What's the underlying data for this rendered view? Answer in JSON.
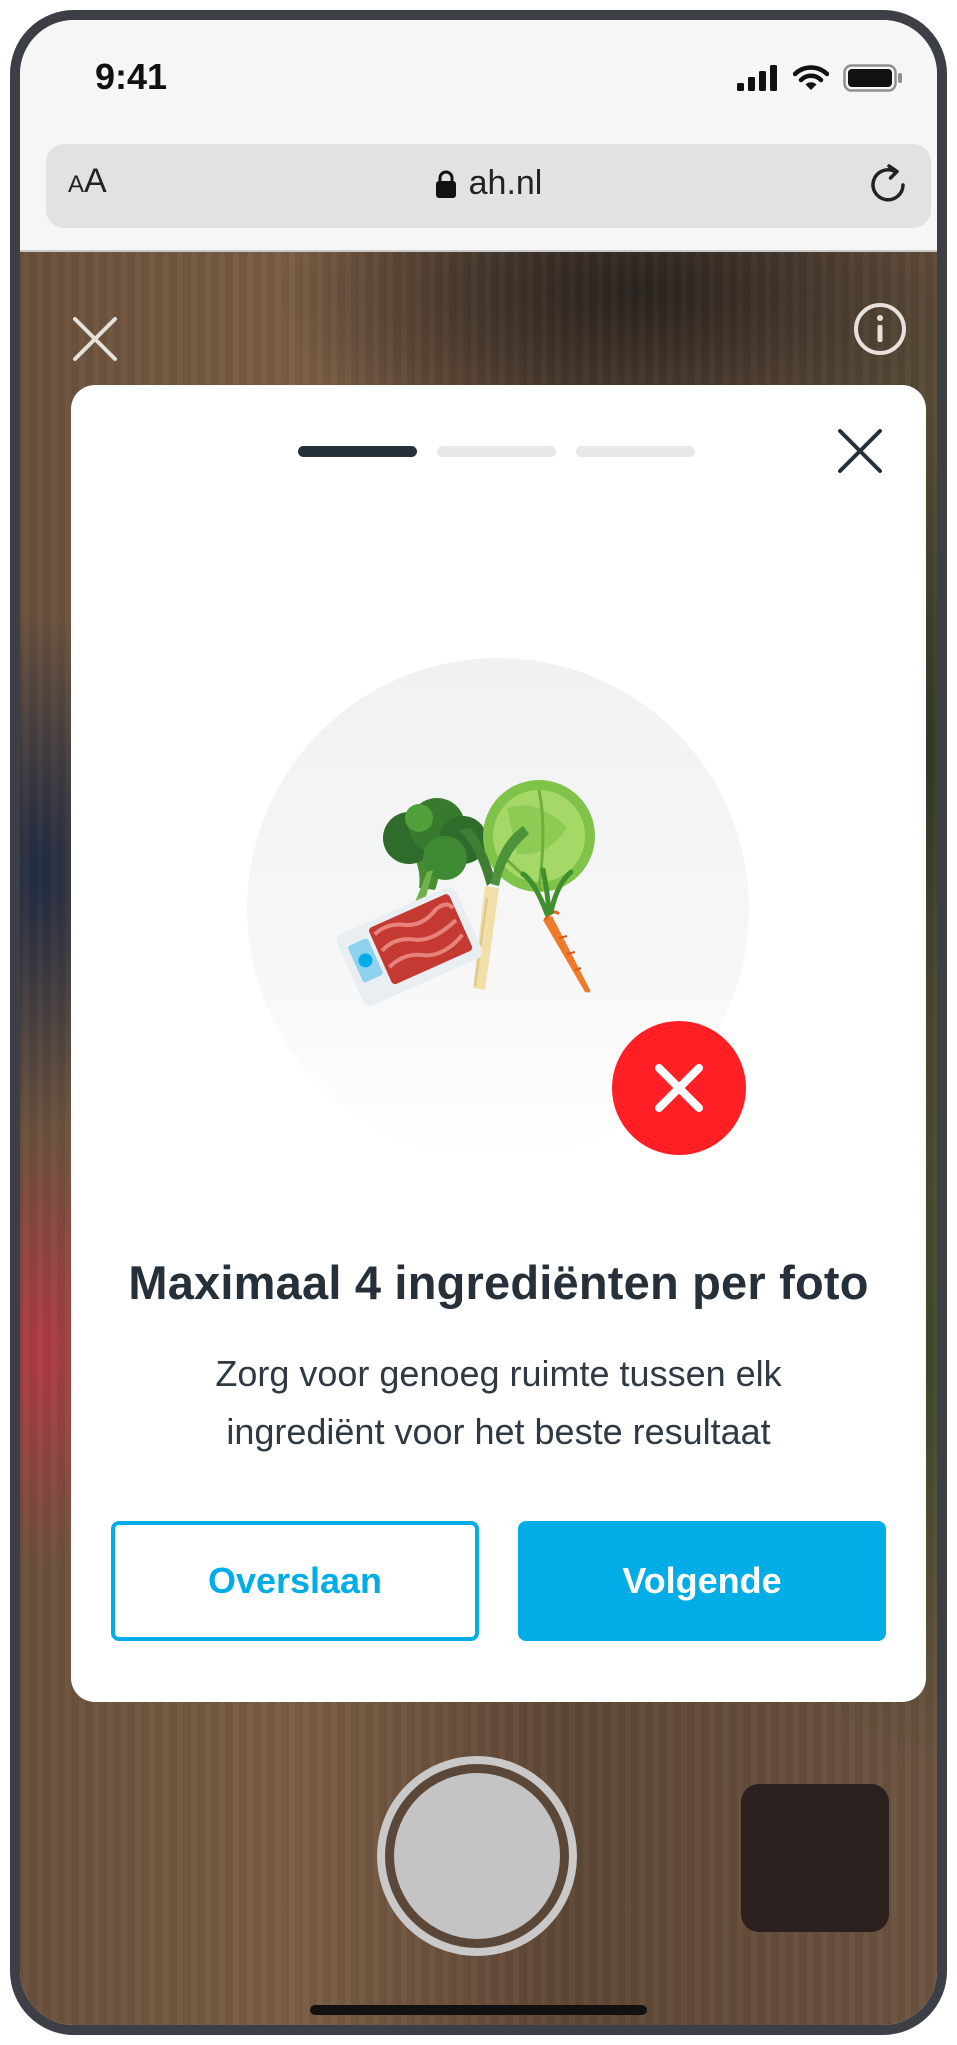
{
  "status_bar": {
    "time": "9:41",
    "icons": [
      "cellular-signal-icon",
      "wifi-icon",
      "battery-icon"
    ]
  },
  "browser": {
    "text_size_button": {
      "small": "A",
      "large": "A"
    },
    "url": "ah.nl",
    "lock_icon": "lock-icon",
    "reload_icon": "reload-icon"
  },
  "camera": {
    "close_icon": "close-icon",
    "info_icon": "info-icon",
    "shutter_icon": "shutter-button",
    "gallery_icon": "gallery-thumbnail"
  },
  "modal": {
    "steps_total": 3,
    "current_step": 1,
    "close_icon": "close-icon",
    "illustration": "ingredients-illustration",
    "status_icon": "error-x-icon",
    "title": "Maximaal 4 ingrediënten per foto",
    "description": "Zorg voor genoeg ruimte tussen elk ingrediënt voor het beste resultaat",
    "skip_label": "Overslaan",
    "next_label": "Volgende"
  },
  "colors": {
    "brand_blue": "#00ade6",
    "text_dark": "#25303a",
    "error_red": "#ff1f24",
    "progress_inactive": "#e6e8ea"
  }
}
